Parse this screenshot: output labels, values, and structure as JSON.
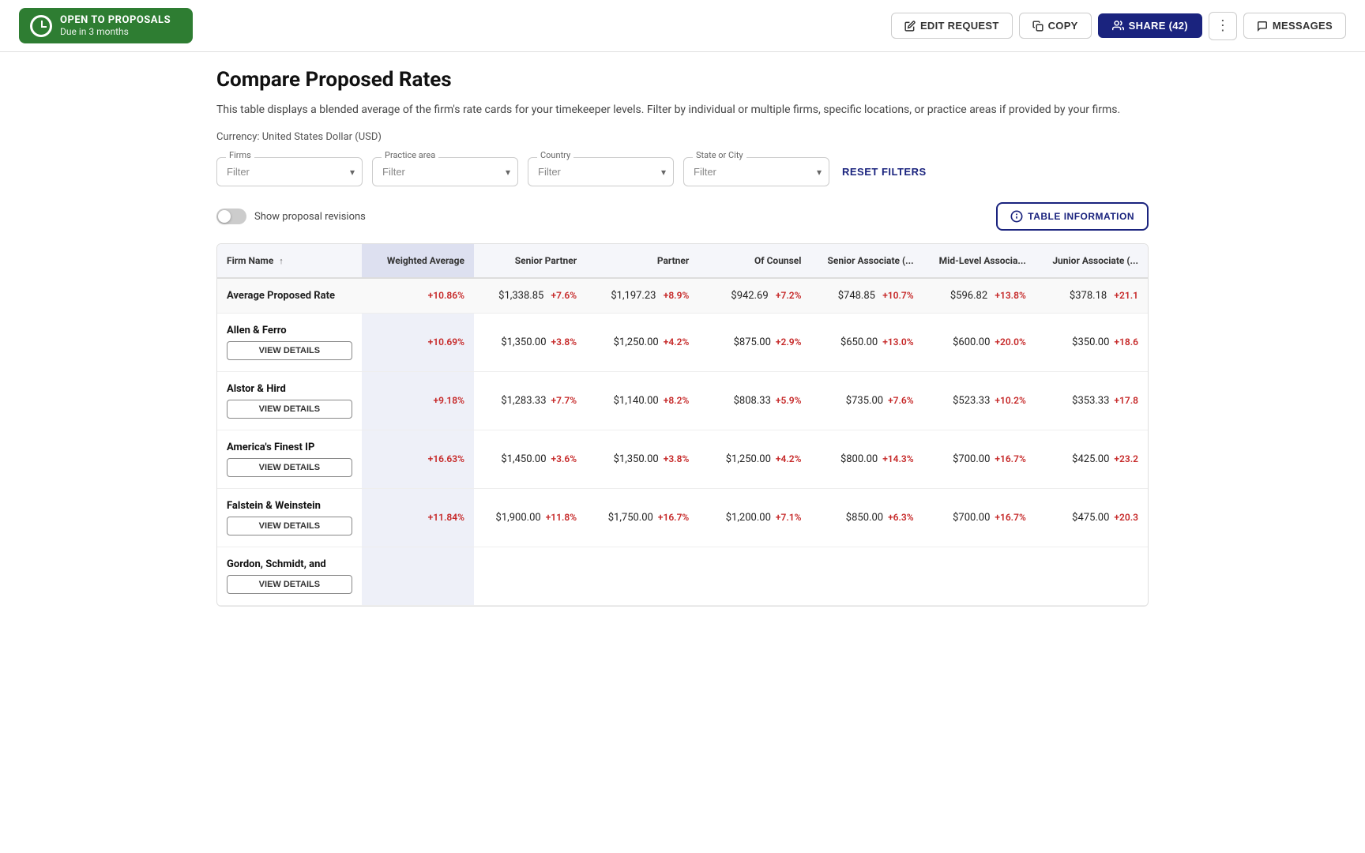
{
  "topbar": {
    "badge": {
      "title": "OPEN TO PROPOSALS",
      "subtitle": "Due in 3 months"
    },
    "edit_request_label": "EDIT REQUEST",
    "copy_label": "COPY",
    "share_label": "SHARE (42)",
    "messages_label": "MESSAGES"
  },
  "page": {
    "title": "Compare Proposed Rates",
    "description": "This table displays a blended average of the firm's rate cards for your timekeeper levels. Filter by individual or multiple firms, specific locations, or practice areas if provided by your firms.",
    "currency_label": "Currency: United States Dollar (USD)"
  },
  "filters": {
    "firms_label": "Firms",
    "firms_placeholder": "Filter",
    "practice_label": "Practice area",
    "practice_placeholder": "Filter",
    "country_label": "Country",
    "country_placeholder": "Filter",
    "state_city_label": "State or City",
    "state_city_placeholder": "Filter",
    "reset_label": "RESET FILTERS"
  },
  "revisions": {
    "toggle_label": "Show proposal revisions"
  },
  "table_info_label": "TABLE INFORMATION",
  "table": {
    "columns": [
      "Firm Name",
      "Weighted Average",
      "Senior Partner",
      "Partner",
      "Of Counsel",
      "Senior Associate (...",
      "Mid-Level Associa...",
      "Junior Associate (..."
    ],
    "avg_row": {
      "label": "Average Proposed Rate",
      "weighted_avg": "+10.86%",
      "senior_partner": "$1,338.85",
      "senior_partner_change": "+7.6%",
      "partner": "$1,197.23",
      "partner_change": "+8.9%",
      "of_counsel": "$942.69",
      "of_counsel_change": "+7.2%",
      "senior_assoc": "$748.85",
      "senior_assoc_change": "+10.7%",
      "mid_assoc": "$596.82",
      "mid_assoc_change": "+13.8%",
      "junior_assoc": "$378.18",
      "junior_assoc_change": "+21.1"
    },
    "firms": [
      {
        "name": "Allen & Ferro",
        "weighted_avg": "+10.69%",
        "senior_partner": "$1,350.00",
        "senior_partner_change": "+3.8%",
        "partner": "$1,250.00",
        "partner_change": "+4.2%",
        "of_counsel": "$875.00",
        "of_counsel_change": "+2.9%",
        "senior_assoc": "$650.00",
        "senior_assoc_change": "+13.0%",
        "mid_assoc": "$600.00",
        "mid_assoc_change": "+20.0%",
        "junior_assoc": "$350.00",
        "junior_assoc_change": "+18.6"
      },
      {
        "name": "Alstor & Hird",
        "weighted_avg": "+9.18%",
        "senior_partner": "$1,283.33",
        "senior_partner_change": "+7.7%",
        "partner": "$1,140.00",
        "partner_change": "+8.2%",
        "of_counsel": "$808.33",
        "of_counsel_change": "+5.9%",
        "senior_assoc": "$735.00",
        "senior_assoc_change": "+7.6%",
        "mid_assoc": "$523.33",
        "mid_assoc_change": "+10.2%",
        "junior_assoc": "$353.33",
        "junior_assoc_change": "+17.8"
      },
      {
        "name": "America's Finest IP",
        "weighted_avg": "+16.63%",
        "senior_partner": "$1,450.00",
        "senior_partner_change": "+3.6%",
        "partner": "$1,350.00",
        "partner_change": "+3.8%",
        "of_counsel": "$1,250.00",
        "of_counsel_change": "+4.2%",
        "senior_assoc": "$800.00",
        "senior_assoc_change": "+14.3%",
        "mid_assoc": "$700.00",
        "mid_assoc_change": "+16.7%",
        "junior_assoc": "$425.00",
        "junior_assoc_change": "+23.2"
      },
      {
        "name": "Falstein & Weinstein",
        "weighted_avg": "+11.84%",
        "senior_partner": "$1,900.00",
        "senior_partner_change": "+11.8%",
        "partner": "$1,750.00",
        "partner_change": "+16.7%",
        "of_counsel": "$1,200.00",
        "of_counsel_change": "+7.1%",
        "senior_assoc": "$850.00",
        "senior_assoc_change": "+6.3%",
        "mid_assoc": "$700.00",
        "mid_assoc_change": "+16.7%",
        "junior_assoc": "$475.00",
        "junior_assoc_change": "+20.3"
      },
      {
        "name": "Gordon, Schmidt, and",
        "weighted_avg": "",
        "senior_partner": "",
        "senior_partner_change": "",
        "partner": "",
        "partner_change": "",
        "of_counsel": "",
        "of_counsel_change": "",
        "senior_assoc": "",
        "senior_assoc_change": "",
        "mid_assoc": "",
        "mid_assoc_change": "",
        "junior_assoc": "",
        "junior_assoc_change": ""
      }
    ]
  }
}
